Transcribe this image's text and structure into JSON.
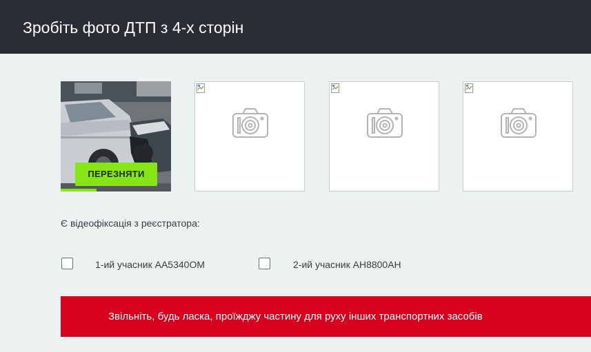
{
  "header": {
    "title": "Зробіть фото ДТП з 4-х сторін"
  },
  "photos": {
    "slot1": {
      "retake_label": "ПЕРЕЗНЯТИ"
    }
  },
  "video": {
    "label": "Є відеофіксація з реєстратора:",
    "participants": [
      {
        "label": "1-ий учасник АА5340ОМ",
        "checked": false
      },
      {
        "label": "2-ий учасник АН8800АН",
        "checked": false
      }
    ]
  },
  "alert": {
    "message": "Звільніть, будь ласка, проїжджу частину для руху інших транспортних засобів",
    "color": "#d7001d"
  },
  "colors": {
    "header_bg": "#2b2d36",
    "accent_green": "#86e615",
    "page_bg": "#ecf2f1"
  },
  "icons": [
    "broken-image-icon",
    "camera-icon"
  ]
}
